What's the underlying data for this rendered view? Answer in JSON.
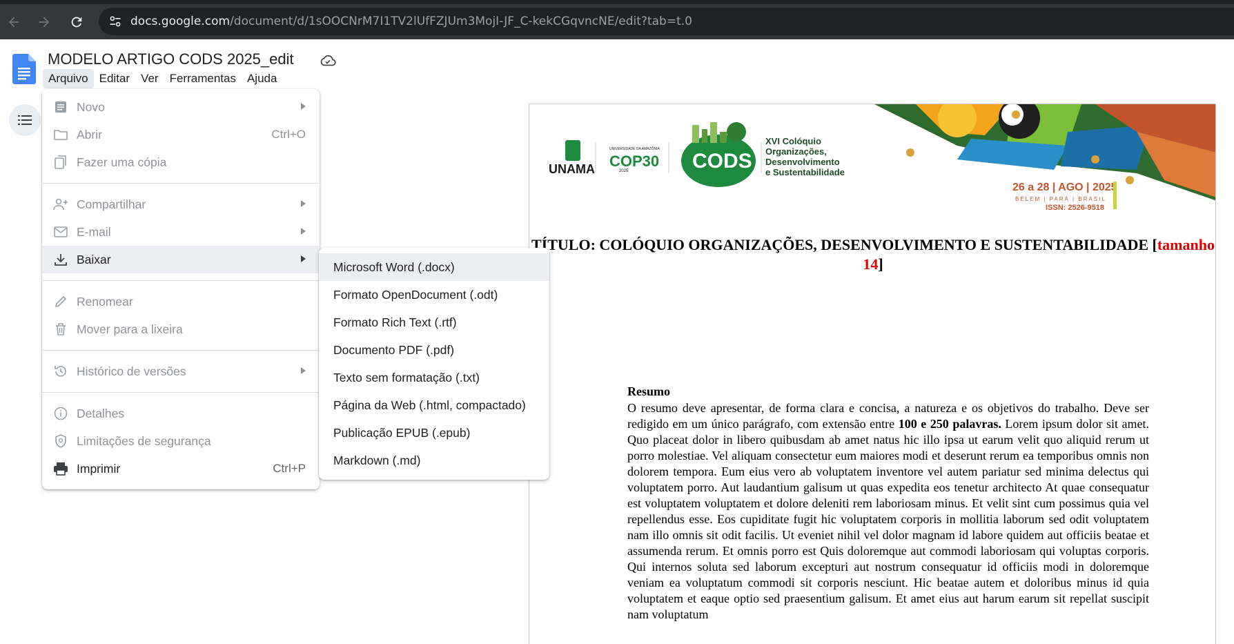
{
  "browser": {
    "url_domain": "docs.google.com",
    "url_path": "/document/d/1sOOCNrM7I1TV2lUfFZJUm3MojI-JF_C-kekCGqvncNE/edit?tab=t.0"
  },
  "doc": {
    "title": "MODELO ARTIGO CODS 2025_edit"
  },
  "menubar": {
    "items": [
      "Arquivo",
      "Editar",
      "Ver",
      "Ferramentas",
      "Ajuda"
    ]
  },
  "file_menu": {
    "novo": "Novo",
    "abrir": "Abrir",
    "abrir_shortcut": "Ctrl+O",
    "copia": "Fazer uma cópia",
    "compartilhar": "Compartilhar",
    "email": "E-mail",
    "baixar": "Baixar",
    "renomear": "Renomear",
    "lixeira": "Mover para a lixeira",
    "historico": "Histórico de versões",
    "detalhes": "Detalhes",
    "seguranca": "Limitações de segurança",
    "imprimir": "Imprimir",
    "imprimir_shortcut": "Ctrl+P"
  },
  "download_menu": {
    "items": [
      "Microsoft Word (.docx)",
      "Formato OpenDocument (.odt)",
      "Formato Rich Text (.rtf)",
      "Documento PDF (.pdf)",
      "Texto sem formatação (.txt)",
      "Página da Web (.html, compactado)",
      "Publicação EPUB (.epub)",
      "Markdown (.md)"
    ]
  },
  "banner": {
    "unama": "UNAMA",
    "univ": "UNIVERSIDADE DA AMAZÔNIA",
    "cop": "COP30",
    "cop_year": "2025",
    "cods": "CODS",
    "event_line1": "XVI Colóquio",
    "event_line2": "Organizações,",
    "event_line3": "Desenvolvimento",
    "event_line4": "e Sustentabilidade",
    "dates": "26 a 28 | AGO | 2025",
    "place": "BELEM | PARÁ | BRASIL",
    "issn": "ISSN: 2526-9518"
  },
  "document": {
    "heading_main": "TÍTULO: COLÓQUIO ORGANIZAÇÕES, DESENVOLVIMENTO E SUSTENTABILIDADE [",
    "heading_red": "tamanho 14",
    "heading_close": "]",
    "resumo_title": "Resumo",
    "resumo_part1": "O resumo deve apresentar, de forma clara e concisa, a natureza e os objetivos do trabalho. Deve ser redigido em um único parágrafo, com extensão entre ",
    "resumo_bold": "100 e 250 palavras.",
    "resumo_part2": " Lorem ipsum dolor sit amet. Quo placeat dolor in libero quibusdam ab amet natus hic illo ipsa ut earum velit quo aliquid rerum ut porro molestiae. Vel aliquam consectetur eum maiores modi et deserunt rerum ea temporibus omnis non dolorem tempora. Eum eius vero ab voluptatem inventore vel autem pariatur sed minima delectus qui voluptatem porro. Aut laudantium galisum ut quas expedita eos tenetur architecto At quae consequatur est voluptatem voluptatem et dolore deleniti rem laboriosam minus. Et velit sint cum possimus quia vel repellendus esse. Eos cupiditate fugit hic voluptatem corporis in mollitia laborum sed odit voluptatem nam illo omnis sit odit facilis. Ut eveniet nihil vel dolor magnam id labore quidem aut officiis beatae et assumenda rerum. Et omnis porro est Quis doloremque aut commodi laboriosam qui voluptas corporis. Qui internos soluta sed laborum excepturi aut nostrum consequatur id officiis modi in doloremque veniam ea voluptatum commodi sit corporis nesciunt. Hic beatae autem et doloribus minus id quia voluptatem et eaque optio sed praesentium galisum. Et amet eius aut harum earum sit repellat suscipit nam voluptatum"
  },
  "colors": {
    "accent_blue": "#4285f4",
    "cods_green": "#1e8a3e",
    "red_note": "#e00000"
  }
}
